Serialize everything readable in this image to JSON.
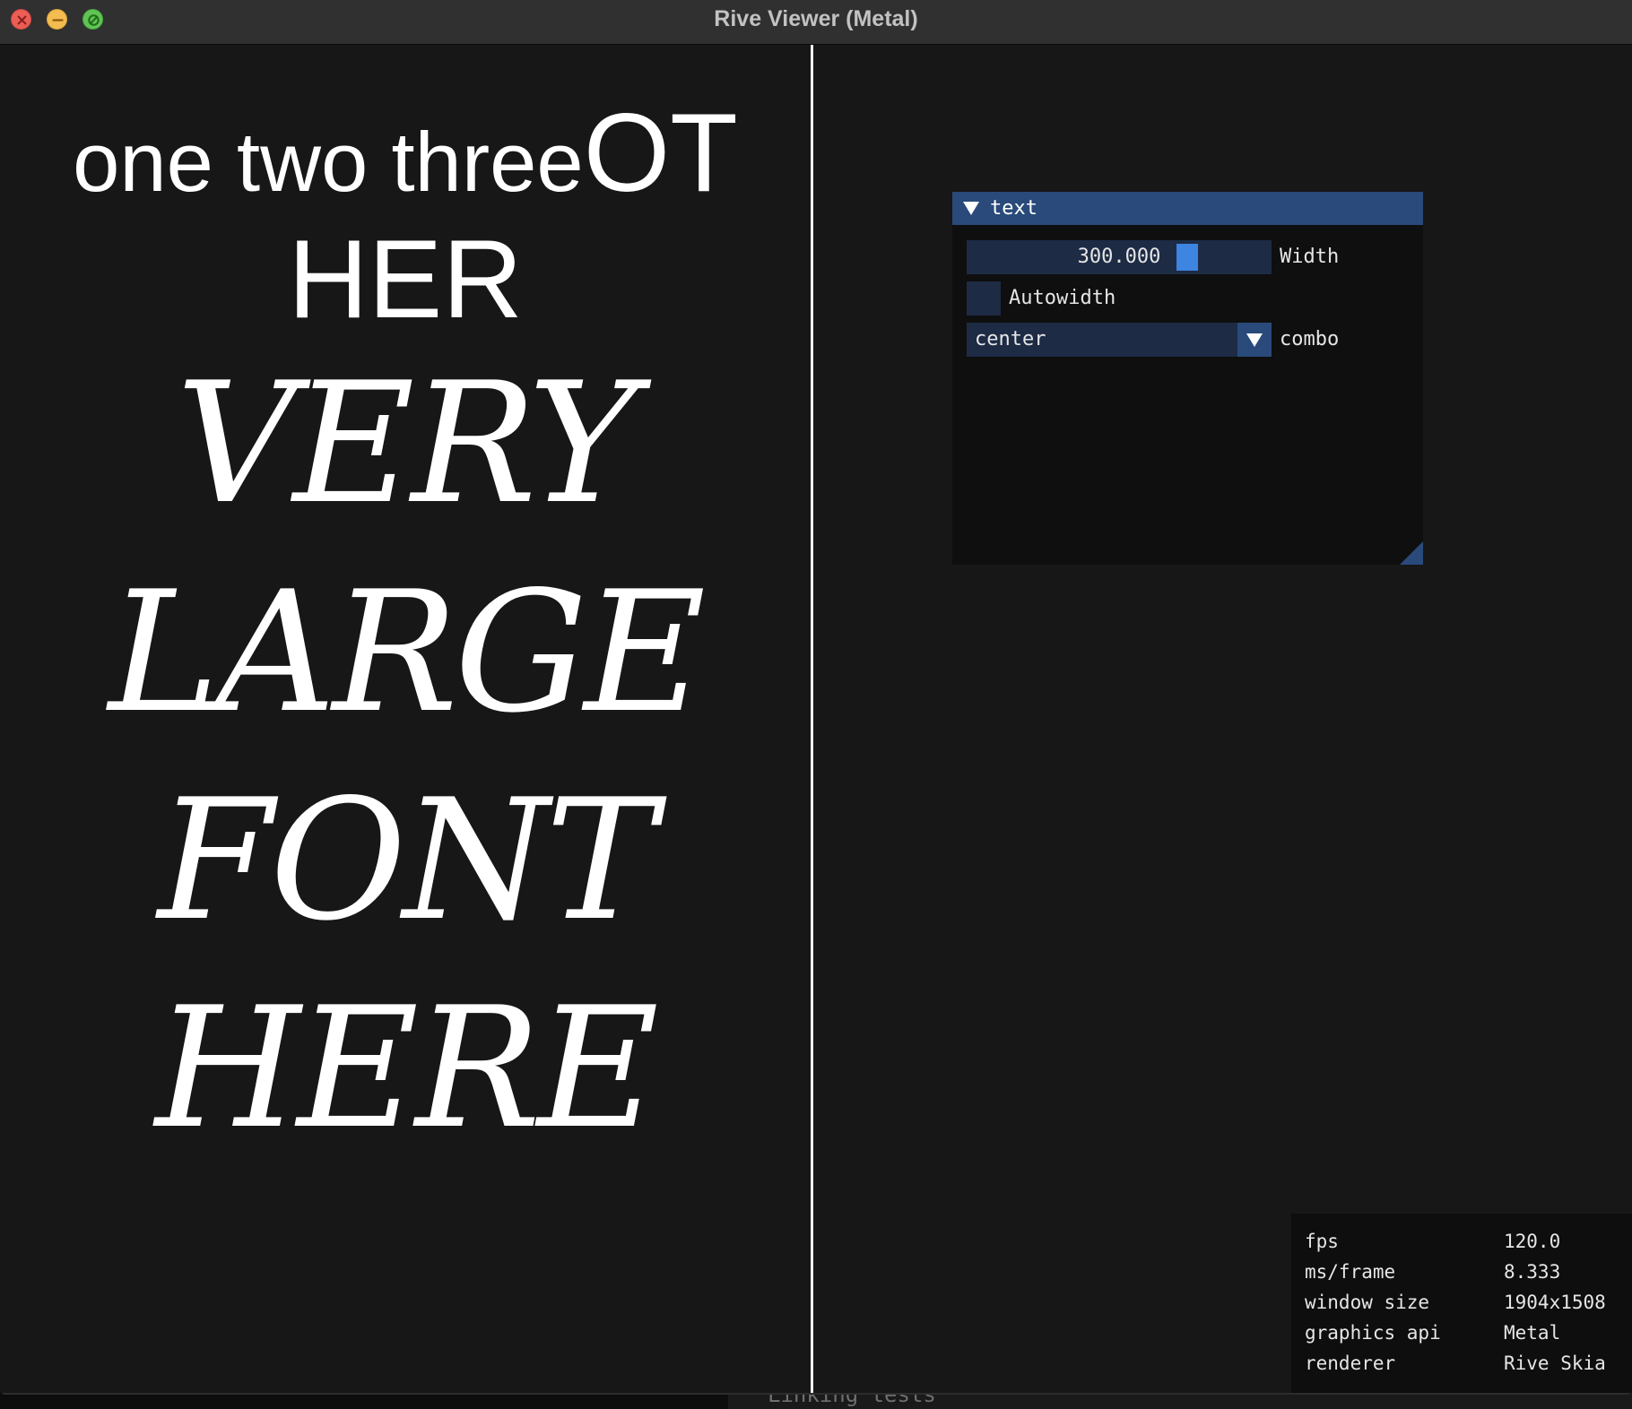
{
  "window": {
    "title": "Rive Viewer (Metal)"
  },
  "canvas": {
    "line1_small": "one two three",
    "line1_big": "OT",
    "line2": "HER",
    "serif_lines": [
      "VERY",
      "LARGE",
      "FONT",
      "HERE"
    ]
  },
  "panel": {
    "header_title": "text",
    "width_value": "300.000",
    "width_label": "Width",
    "autowidth_label": "Autowidth",
    "combo_value": "center",
    "combo_label": "combo"
  },
  "stats": {
    "rows": [
      {
        "key": "fps",
        "value": "120.0"
      },
      {
        "key": "ms/frame",
        "value": "8.333"
      },
      {
        "key": "window size",
        "value": "1904x1508"
      },
      {
        "key": "graphics api",
        "value": "Metal"
      },
      {
        "key": "renderer",
        "value": "Rive Skia"
      }
    ]
  },
  "background": {
    "terminal_text": "Linking tests"
  },
  "colors": {
    "canvas_bg": "#171717",
    "imgui_accent": "#294a7a",
    "imgui_frame": "#1d2b45",
    "slider_grab": "#3d85e0",
    "traffic_close": "#ec5d56",
    "traffic_min": "#f3bd4f",
    "traffic_zoom": "#5fc454"
  }
}
